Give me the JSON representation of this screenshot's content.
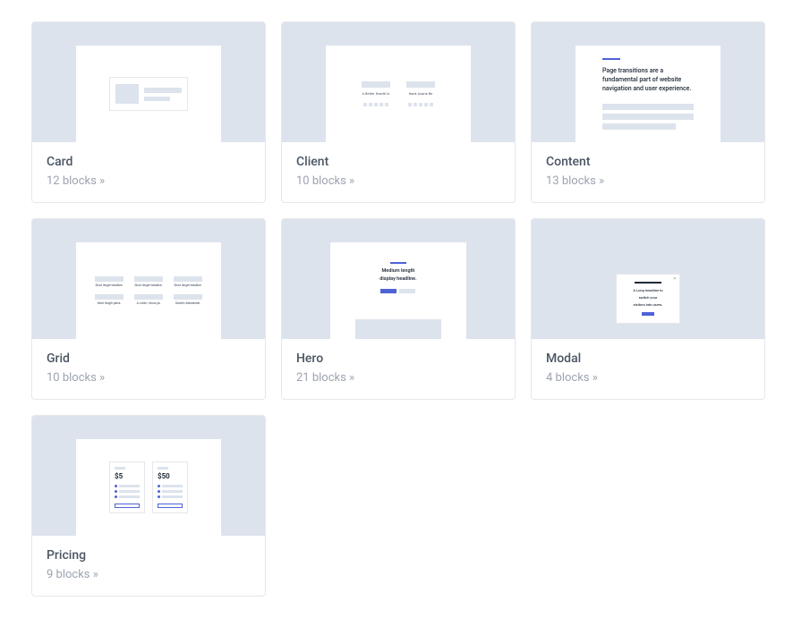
{
  "categories": [
    {
      "id": "card",
      "title": "Card",
      "count_label": "12 blocks"
    },
    {
      "id": "client",
      "title": "Client",
      "count_label": "10 blocks"
    },
    {
      "id": "content",
      "title": "Content",
      "count_label": "13 blocks"
    },
    {
      "id": "grid",
      "title": "Grid",
      "count_label": "10 blocks"
    },
    {
      "id": "hero",
      "title": "Hero",
      "count_label": "21 blocks"
    },
    {
      "id": "modal",
      "title": "Modal",
      "count_label": "4 blocks"
    },
    {
      "id": "pricing",
      "title": "Pricing",
      "count_label": "9 blocks"
    }
  ],
  "previews": {
    "client": {
      "label_a": "A Better Health Is",
      "label_b": "Hank Azaria Be"
    },
    "content": {
      "headline": "Page transitions are a fundamental part of website navigation and user experience."
    },
    "grid": {
      "cells": [
        "Short length headline.",
        "Short length headline.",
        "Short length headline.",
        "Short length pains.",
        "A Leslie, I know ya.",
        "Dante's dishwasher."
      ]
    },
    "hero": {
      "headline_1": "Medium length",
      "headline_2": "display headline."
    },
    "modal": {
      "line1": "A Long headline to",
      "line2": "switch your",
      "line3": "visitors into users."
    },
    "pricing": {
      "price_a": "$5",
      "price_b": "$50"
    }
  },
  "colors": {
    "accent": "#4f62d7",
    "muted_bg": "#dde3ec",
    "text_title": "#4b5563",
    "text_muted": "#9ca3af"
  }
}
